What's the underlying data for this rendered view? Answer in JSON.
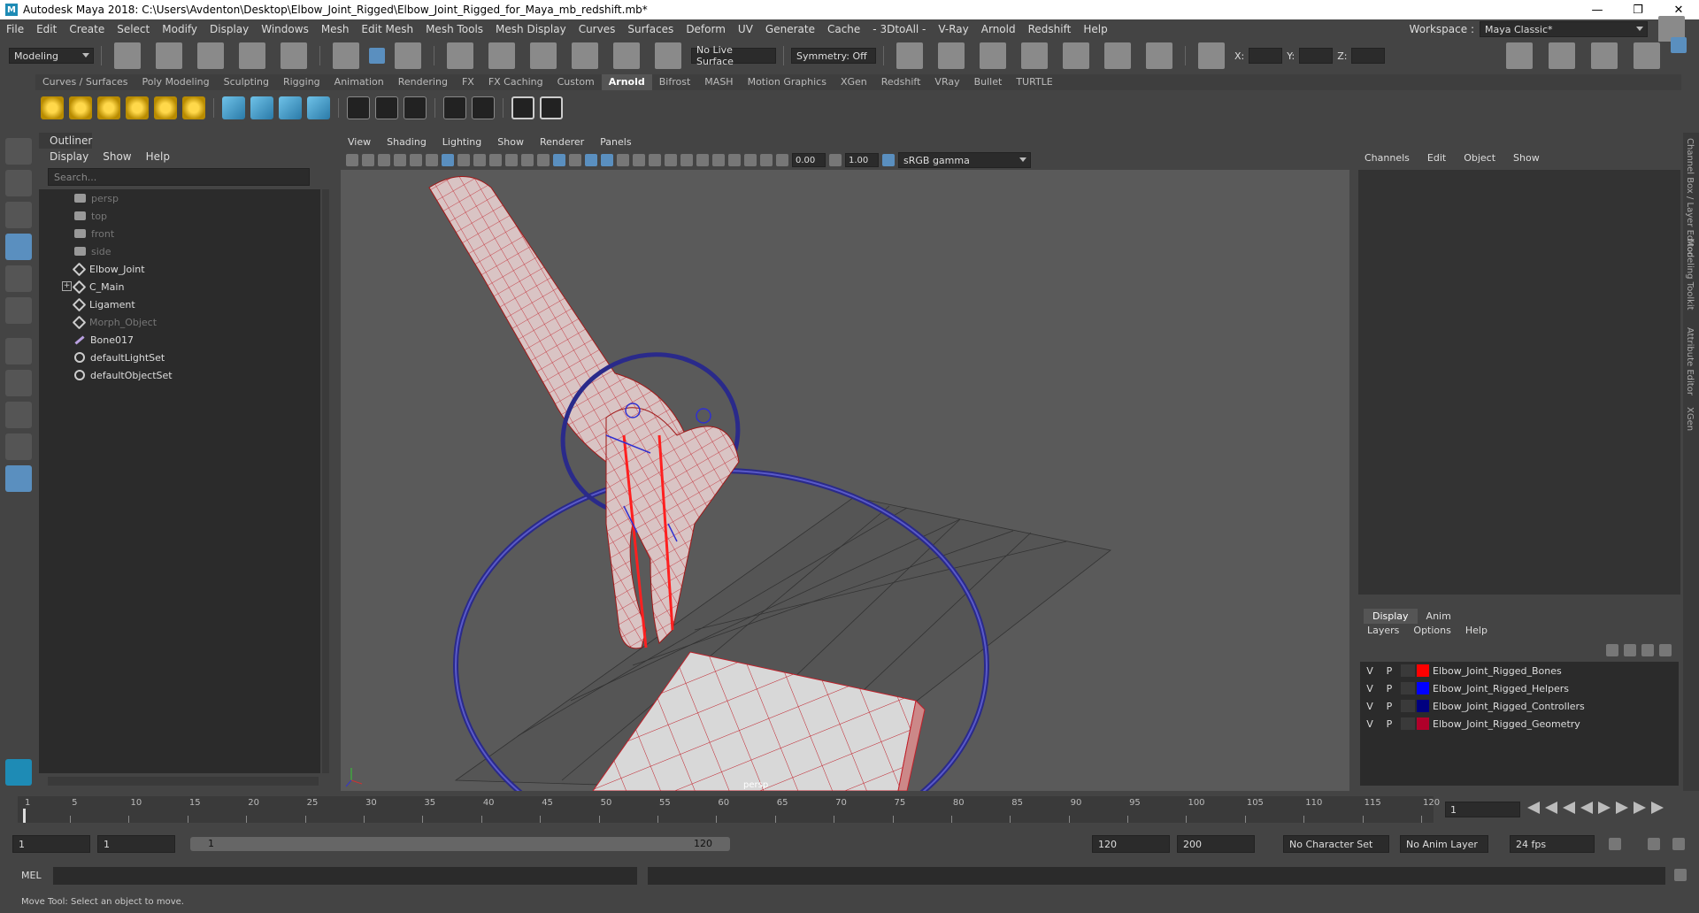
{
  "window": {
    "title": "Autodesk Maya 2018: C:\\Users\\Avdenton\\Desktop\\Elbow_Joint_Rigged\\Elbow_Joint_Rigged_for_Maya_mb_redshift.mb*",
    "logo": "M"
  },
  "menubar": {
    "items": [
      "File",
      "Edit",
      "Create",
      "Select",
      "Modify",
      "Display",
      "Windows",
      "Mesh",
      "Edit Mesh",
      "Mesh Tools",
      "Mesh Display",
      "Curves",
      "Surfaces",
      "Deform",
      "UV",
      "Generate",
      "Cache",
      "- 3DtoAll -",
      "V-Ray",
      "Arnold",
      "Redshift",
      "Help"
    ],
    "workspace_label": "Workspace :",
    "workspace_value": "Maya Classic*"
  },
  "statusline": {
    "mode": "Modeling",
    "live_surface": "No Live Surface",
    "symmetry": "Symmetry: Off",
    "x_label": "X:",
    "y_label": "Y:",
    "z_label": "Z:"
  },
  "shelf": {
    "tabs": [
      "Curves / Surfaces",
      "Poly Modeling",
      "Sculpting",
      "Rigging",
      "Animation",
      "Rendering",
      "FX",
      "FX Caching",
      "Custom",
      "Arnold",
      "Bifrost",
      "MASH",
      "Motion Graphics",
      "XGen",
      "Redshift",
      "VRay",
      "Bullet",
      "TURTLE"
    ],
    "active": "Arnold"
  },
  "outliner": {
    "title": "Outliner",
    "menu": [
      "Display",
      "Show",
      "Help"
    ],
    "search_placeholder": "Search...",
    "items": [
      {
        "label": "persp",
        "icon": "camera-icon",
        "dim": true
      },
      {
        "label": "top",
        "icon": "camera-icon",
        "dim": true
      },
      {
        "label": "front",
        "icon": "camera-icon",
        "dim": true
      },
      {
        "label": "side",
        "icon": "camera-icon",
        "dim": true
      },
      {
        "label": "Elbow_Joint",
        "icon": "transform-icon",
        "dim": false
      },
      {
        "label": "C_Main",
        "icon": "transform-icon",
        "dim": false,
        "expandable": true
      },
      {
        "label": "Ligament",
        "icon": "transform-icon",
        "dim": false
      },
      {
        "label": "Morph_Object",
        "icon": "transform-icon",
        "dim": true
      },
      {
        "label": "Bone017",
        "icon": "bone-icon",
        "dim": false
      },
      {
        "label": "defaultLightSet",
        "icon": "set-icon",
        "dim": false
      },
      {
        "label": "defaultObjectSet",
        "icon": "set-icon",
        "dim": false
      }
    ]
  },
  "viewport": {
    "menu": [
      "View",
      "Shading",
      "Lighting",
      "Show",
      "Renderer",
      "Panels"
    ],
    "exposure": "0.00",
    "gamma": "1.00",
    "color_space": "sRGB gamma",
    "camera_label": "persp"
  },
  "channelbox": {
    "tabs": [
      "Channels",
      "Edit",
      "Object",
      "Show"
    ]
  },
  "layers": {
    "tabs": [
      "Display",
      "Anim"
    ],
    "menu": [
      "Layers",
      "Options",
      "Help"
    ],
    "items": [
      {
        "v": "V",
        "p": "P",
        "name": "Elbow_Joint_Rigged_Bones",
        "color": "#ff0000"
      },
      {
        "v": "V",
        "p": "P",
        "name": "Elbow_Joint_Rigged_Helpers",
        "color": "#0000ff"
      },
      {
        "v": "V",
        "p": "P",
        "name": "Elbow_Joint_Rigged_Controllers",
        "color": "#000080"
      },
      {
        "v": "V",
        "p": "P",
        "name": "Elbow_Joint_Rigged_Geometry",
        "color": "#b0002a"
      }
    ]
  },
  "sidebar_tabs": [
    "Channel Box / Layer Editor",
    "Modeling Toolkit",
    "Attribute Editor",
    "XGen"
  ],
  "timeline": {
    "ticks": [
      "1",
      "5",
      "10",
      "15",
      "20",
      "25",
      "30",
      "35",
      "40",
      "45",
      "50",
      "55",
      "60",
      "65",
      "70",
      "75",
      "80",
      "85",
      "90",
      "95",
      "100",
      "105",
      "110",
      "115",
      "120"
    ],
    "current_frame": "1"
  },
  "range": {
    "start": "1",
    "anim_start": "1",
    "range_start": "1",
    "range_end": "120",
    "end": "120",
    "anim_end": "200",
    "character_set": "No Character Set",
    "anim_layer": "No Anim Layer",
    "fps": "24 fps"
  },
  "mel": {
    "label": "MEL"
  },
  "help_line": "Move Tool: Select an object to move."
}
